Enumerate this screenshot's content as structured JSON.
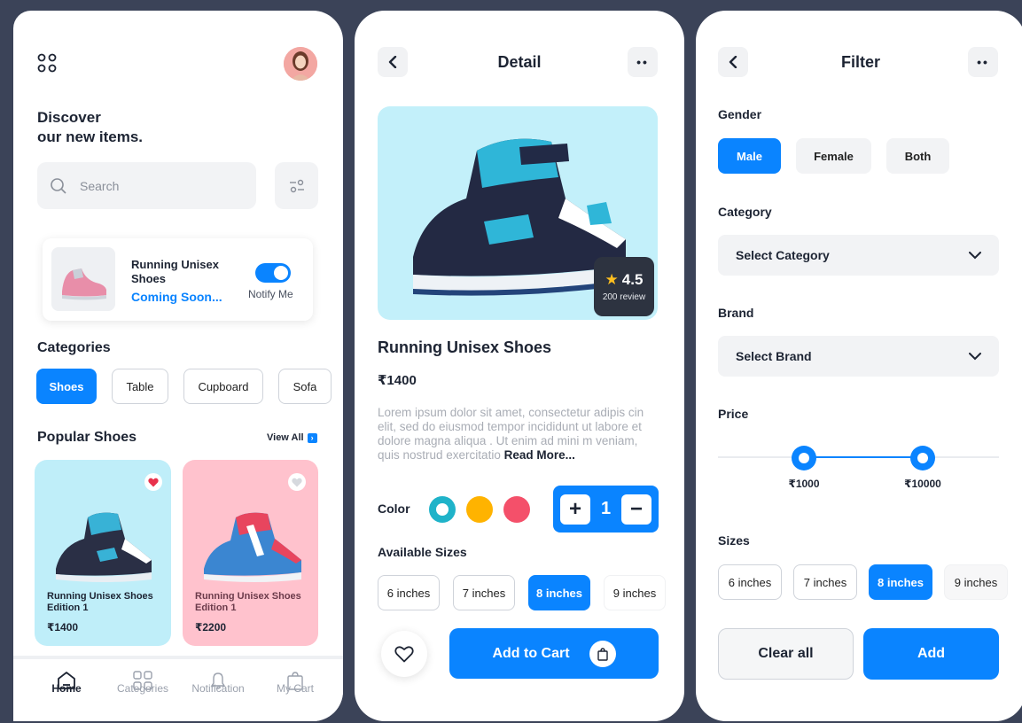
{
  "home": {
    "heading_line1": "Discover",
    "heading_line2": "our new items.",
    "search_placeholder": "Search",
    "promo": {
      "title_line1": "Running Unisex",
      "title_line2": "Shoes",
      "subtitle": "Coming Soon...",
      "toggle_label": "Notify Me",
      "toggle_on": true
    },
    "categories_title": "Categories",
    "categories": [
      "Shoes",
      "Table",
      "Cupboard",
      "Sofa"
    ],
    "popular_title": "Popular Shoes",
    "view_all": "View All",
    "products": [
      {
        "name_line1": "Running Unisex Shoes",
        "name_line2": "Edition 1",
        "price": "₹1400",
        "favorite": true,
        "bg": "#bfeef9"
      },
      {
        "name_line1": "Running Unisex Shoes",
        "name_line2": "Edition 1",
        "price": "₹2200",
        "favorite": false,
        "bg": "#ffc2cd"
      }
    ],
    "nav": [
      "Home",
      "Categories",
      "Notification",
      "My Cart"
    ],
    "nav_active": "Home"
  },
  "detail": {
    "title": "Detail",
    "rating": "4.5",
    "reviews": "200 review",
    "name": "Running Unisex Shoes",
    "price": "₹1400",
    "description": "Lorem ipsum dolor sit amet, consectetur adipis cin elit, sed do eiusmod tempor incididunt ut labore et dolore magna aliqua . Ut enim ad mini m veniam, quis nostrud exercitatio",
    "read_more": "Read More...",
    "color_label": "Color",
    "colors": [
      "#1fb3c9",
      "#ffb300",
      "#f4506a"
    ],
    "quantity": "1",
    "sizes_label": "Available Sizes",
    "sizes": [
      "6 inches",
      "7 inches",
      "8 inches",
      "9 inches"
    ],
    "size_selected": "8 inches",
    "add_to_cart": "Add to Cart"
  },
  "filter": {
    "title": "Filter",
    "gender_label": "Gender",
    "genders": [
      "Male",
      "Female",
      "Both"
    ],
    "gender_selected": "Male",
    "category_label": "Category",
    "category_value": "Select Category",
    "brand_label": "Brand",
    "brand_value": "Select Brand",
    "price_label": "Price",
    "price_min": "₹1000",
    "price_max": "₹10000",
    "sizes_label": "Sizes",
    "sizes": [
      "6 inches",
      "7 inches",
      "8 inches",
      "9 inches"
    ],
    "size_selected": "8 inches",
    "clear": "Clear all",
    "add": "Add"
  },
  "colors": {
    "accent": "#0a84ff",
    "light_blue": "#bfeef9",
    "pink": "#ffc2cd"
  }
}
